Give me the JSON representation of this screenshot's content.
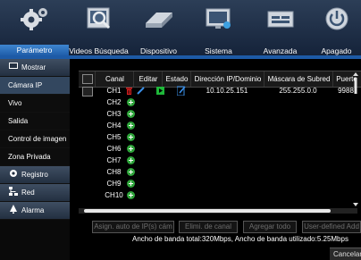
{
  "menu": [
    {
      "label": "Parámetro",
      "icon": "gears-icon"
    },
    {
      "label": "Videos Búsqueda",
      "icon": "video-search-icon"
    },
    {
      "label": "Dispositivo",
      "icon": "hard-disk-icon"
    },
    {
      "label": "Sistema",
      "icon": "monitor-icon"
    },
    {
      "label": "Avanzada",
      "icon": "advanced-tools-icon"
    },
    {
      "label": "Apagado",
      "icon": "power-icon"
    }
  ],
  "sidebar": {
    "mostrar": "Mostrar",
    "camara_ip": "Cámara IP",
    "vivo": "Vivo",
    "salida": "Salida",
    "control_imagen": "Control de imagen",
    "zona_privada": "Zona Privada",
    "registro": "Registro",
    "red": "Red",
    "alarma": "Alarma"
  },
  "table": {
    "headers": {
      "canal": "Canal",
      "editar": "Editar",
      "estado": "Estado",
      "direccion": "Dirección IP/Dominio",
      "mascara": "Máscara de Subred",
      "puerto": "Puerto"
    },
    "rows": [
      {
        "canal": "CH1",
        "ip": "10.10.25.151",
        "mask": "255.255.0.0",
        "port": "9988"
      },
      {
        "canal": "CH2"
      },
      {
        "canal": "CH3"
      },
      {
        "canal": "CH4"
      },
      {
        "canal": "CH5"
      },
      {
        "canal": "CH6"
      },
      {
        "canal": "CH7"
      },
      {
        "canal": "CH8"
      },
      {
        "canal": "CH9"
      },
      {
        "canal": "CH10"
      }
    ]
  },
  "buttons": {
    "asign": "Asign. auto de IP(s) cám",
    "elimi": "Elimi. de canal",
    "agregar": "Agregar todo",
    "user_defined": "User-defined Add"
  },
  "bandwidth": "Ancho de banda total:320Mbps, Ancho de banda utilizado:5.25Mbps",
  "cancel": "Cancelar",
  "colors": {
    "accent": "#1d5aa6",
    "add_green": "#2ea43a",
    "delete_red": "#e02020",
    "status_green": "#1fb83a"
  }
}
